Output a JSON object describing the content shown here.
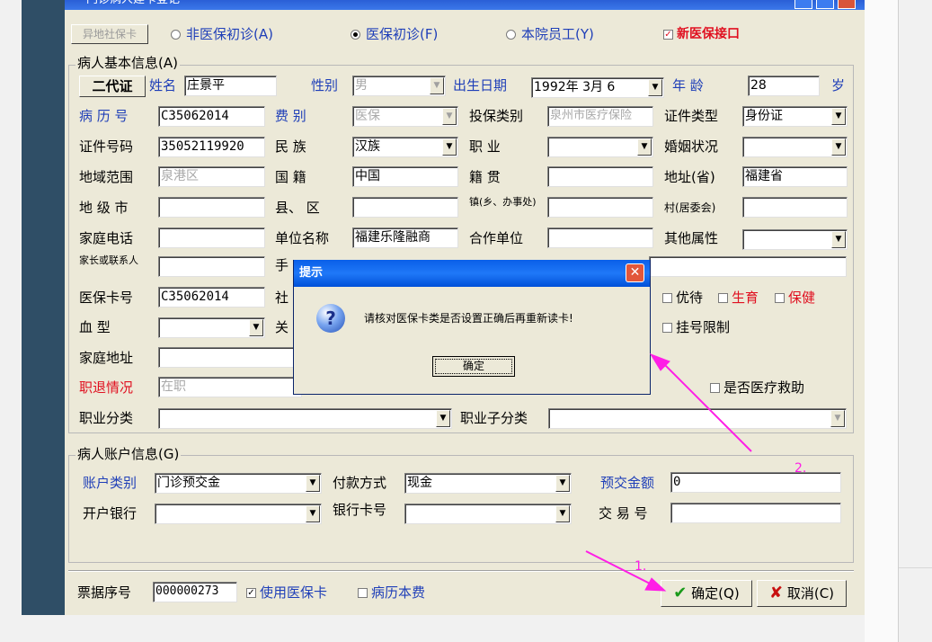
{
  "window": {
    "title": "门诊病人建卡登记"
  },
  "toolbar": {
    "remote_card_label": "异地社保卡",
    "radio_non_insurance": "非医保初诊(A)",
    "radio_insurance": "医保初诊(F)",
    "radio_staff": "本院员工(Y)",
    "new_insurance_label": "新医保接口"
  },
  "basic": {
    "group_title": "病人基本信息(A)",
    "id2_button": "二代证",
    "name_label": "姓名",
    "name_value": "庄景平",
    "gender_label": "性别",
    "gender_value": "男",
    "birth_label": "出生日期",
    "birth_value": "1992年 3月 6",
    "age_label": "年   龄",
    "age_value": "28",
    "age_unit": "岁",
    "record_no_label": "病 历 号",
    "record_no_value": "C35062014",
    "fee_type_label": "费    别",
    "fee_type_value": "医保",
    "insure_type_label": "投保类别",
    "insure_type_value": "泉州市医疗保险",
    "cert_type_label": "证件类型",
    "cert_type_value": "身份证",
    "cert_no_label": "证件号码",
    "cert_no_value": "35052119920",
    "ethnic_label": "民    族",
    "ethnic_value": "汉族",
    "job_label": "职    业",
    "job_value": "",
    "marital_label": "婚姻状况",
    "marital_value": "",
    "region_label": "地域范围",
    "region_value": "泉港区",
    "nation_label": "国    籍",
    "nation_value": "中国",
    "native_label": "籍    贯",
    "native_value": "",
    "province_label": "地址(省)",
    "province_value": "福建省",
    "city_label": "地 级 市",
    "city_value": "",
    "county_label": "县、 区",
    "county_value": "",
    "town_label": "镇(乡、办事处)",
    "town_value": "",
    "village_label": "村(居委会)",
    "village_value": "",
    "home_phone_label": "家庭电话",
    "home_phone_value": "",
    "employer_label": "单位名称",
    "employer_value": "福建乐隆融商",
    "partner_label": "合作单位",
    "partner_value": "",
    "other_attr_label": "其他属性",
    "other_attr_value": "",
    "contact_label": "家长或联系人",
    "contact_value": "",
    "mobile_label": "手",
    "insure_card_label": "医保卡号",
    "insure_card_value": "C35062014",
    "social_label": "社",
    "blood_label": "血    型",
    "blood_value": "",
    "relation_label": "关",
    "address_label": "家庭地址",
    "address_value": "",
    "retire_label": "职退情况",
    "retire_value": "在职",
    "occ_class_label": "职业分类",
    "occ_class_value": "",
    "occ_sub_label": "职业子分类",
    "occ_sub_value": "",
    "priority_label": "优待",
    "birth_ins_label": "生育",
    "health_label": "保健",
    "reg_limit_label": "挂号限制",
    "aid_label": "是否医疗救助"
  },
  "account": {
    "group_title": "病人账户信息(G)",
    "type_label": "账户类别",
    "type_value": "门诊预交金",
    "pay_label": "付款方式",
    "pay_value": "现金",
    "prepay_label": "预交金额",
    "prepay_value": "0",
    "bank_label": "开户银行",
    "bank_value": "",
    "card_label": "银行卡号",
    "card_value": "",
    "trade_label": "交 易 号",
    "trade_value": ""
  },
  "footer": {
    "receipt_label": "票据序号",
    "receipt_value": "000000273",
    "use_card_label": "使用医保卡",
    "record_fee_label": "病历本费",
    "ok_label": "确定(Q)",
    "cancel_label": "取消(C)"
  },
  "dialog": {
    "title": "提示",
    "message": "请核对医保卡类是否设置正确后再重新读卡!",
    "ok_label": "确定"
  },
  "annotations": {
    "step1": "1.",
    "step2": "2."
  },
  "colors": {
    "accent_blue": "#1f3fb8",
    "alert_red": "#e01020",
    "annotation_magenta": "#ff1ee6",
    "window_bg": "#ece9d8"
  }
}
